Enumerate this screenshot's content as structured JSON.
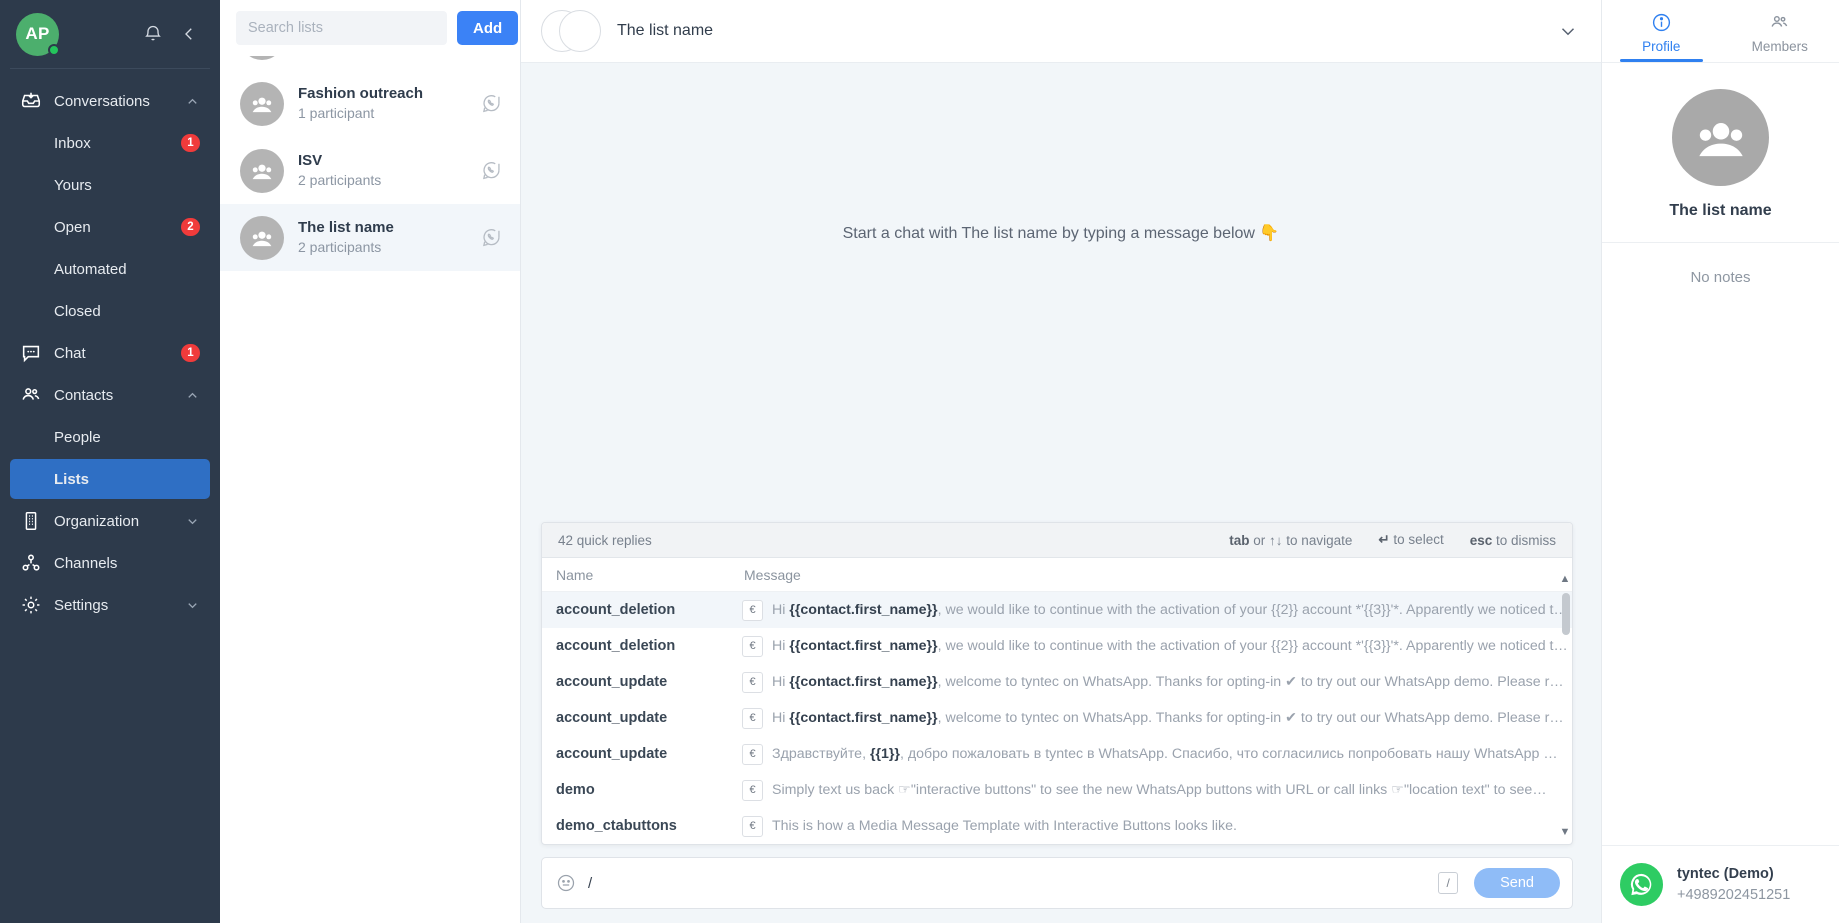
{
  "nav": {
    "avatar_initials": "AP",
    "bell_icon": "bell-icon",
    "collapse_icon": "chevron-left-icon",
    "groups": [
      {
        "id": "conversations",
        "label": "Conversations",
        "icon": "inbox-tray-icon",
        "chevron": "chevron-up-icon",
        "items": [
          {
            "label": "Inbox",
            "badge": "1",
            "active": false
          },
          {
            "label": "Yours",
            "badge": "",
            "active": false
          },
          {
            "label": "Open",
            "badge": "2",
            "active": false
          },
          {
            "label": "Automated",
            "badge": "",
            "active": false
          },
          {
            "label": "Closed",
            "badge": "",
            "active": false
          }
        ]
      },
      {
        "id": "chat",
        "label": "Chat",
        "icon": "chat-bubble-icon",
        "chevron": "",
        "badge": "1",
        "items": []
      },
      {
        "id": "contacts",
        "label": "Contacts",
        "icon": "people-icon",
        "chevron": "chevron-up-icon",
        "items": [
          {
            "label": "People",
            "badge": "",
            "active": false
          },
          {
            "label": "Lists",
            "badge": "",
            "active": true
          }
        ]
      },
      {
        "id": "organization",
        "label": "Organization",
        "icon": "building-icon",
        "chevron": "chevron-down-icon",
        "items": []
      },
      {
        "id": "channels",
        "label": "Channels",
        "icon": "share-nodes-icon",
        "chevron": "",
        "items": []
      },
      {
        "id": "settings",
        "label": "Settings",
        "icon": "gear-icon",
        "chevron": "chevron-down-icon",
        "items": []
      }
    ]
  },
  "lists_panel": {
    "search_placeholder": "Search lists",
    "search_value": "",
    "add_label": "Add",
    "items": [
      {
        "title": "Fashion outreach",
        "subtitle": "1 participant",
        "channel_icon": "whatsapp-outline-icon",
        "selected": false
      },
      {
        "title": "ISV",
        "subtitle": "2 participants",
        "channel_icon": "whatsapp-outline-icon",
        "selected": false
      },
      {
        "title": "The list name",
        "subtitle": "2 participants",
        "channel_icon": "whatsapp-outline-icon",
        "selected": true
      }
    ]
  },
  "chat": {
    "header_title": "The list name",
    "header_chevron": "chevron-down-icon",
    "empty_hint": "Start a chat with The list name by typing a message below 👇",
    "composer": {
      "emoji_icon": "emoji-smiley-icon",
      "value": "/",
      "placeholder": "",
      "slash_icon": "slash-command-icon",
      "send_label": "Send"
    }
  },
  "quick_replies": {
    "count_label": "42 quick replies",
    "hints": [
      {
        "key": "tab",
        "text": " or ↑↓ to navigate"
      },
      {
        "key": "↵",
        "text": " to select"
      },
      {
        "key": "esc",
        "text": " to dismiss"
      }
    ],
    "columns": {
      "name": "Name",
      "message": "Message"
    },
    "rows": [
      {
        "name": "account_deletion",
        "flag": "€",
        "message_prefix": "Hi ",
        "message_bold": "{{contact.first_name}}",
        "message_rest": ", we would like to continue with the activation of your {{2}} account *'{{3}}'*. Apparently we noticed t…",
        "highlight": true
      },
      {
        "name": "account_deletion",
        "flag": "€",
        "message_prefix": "Hi ",
        "message_bold": "{{contact.first_name}}",
        "message_rest": ", we would like to continue with the activation of your {{2}} account *'{{3}}'*. Apparently we noticed t…",
        "highlight": false
      },
      {
        "name": "account_update",
        "flag": "€",
        "message_prefix": "Hi ",
        "message_bold": "{{contact.first_name}}",
        "message_rest": ", welcome to tyntec on WhatsApp. Thanks for opting-in ✔ to try out our WhatsApp demo. Please r…",
        "highlight": false
      },
      {
        "name": "account_update",
        "flag": "€",
        "message_prefix": "Hi ",
        "message_bold": "{{contact.first_name}}",
        "message_rest": ", welcome to tyntec on WhatsApp. Thanks for opting-in ✔ to try out our WhatsApp demo. Please r…",
        "highlight": false
      },
      {
        "name": "account_update",
        "flag": "€",
        "message_prefix": "Здравствуйте, ",
        "message_bold": "{{1}}",
        "message_rest": ", добро пожаловать в tyntec в WhatsApp. Спасибо, что согласились попробовать нашу WhatsApp …",
        "highlight": false
      },
      {
        "name": "demo",
        "flag": "€",
        "message_prefix": "Simply text us back ☞",
        "message_bold": "",
        "message_rest": "\"interactive buttons\" to see the new WhatsApp buttons with URL or call links ☞\"location text\" to see…",
        "highlight": false
      },
      {
        "name": "demo_ctabuttons",
        "flag": "€",
        "message_prefix": "This is how a Media Message Template with Interactive Buttons looks like.",
        "message_bold": "",
        "message_rest": "",
        "highlight": false
      }
    ]
  },
  "right_panel": {
    "tabs": [
      {
        "label": "Profile",
        "icon": "info-circle-icon",
        "active": true
      },
      {
        "label": "Members",
        "icon": "people-icon",
        "active": false
      }
    ],
    "profile_name": "The list name",
    "profile_avatar_icon": "group-avatar-icon",
    "notes_text": "No notes",
    "channel": {
      "icon": "whatsapp-icon",
      "name": "tyntec (Demo)",
      "number": "+4989202451251"
    }
  },
  "colors": {
    "nav_bg": "#2d3a4b",
    "accent_blue": "#3b82f6",
    "active_nav": "#2f6fc4",
    "badge_red": "#f03b3b",
    "whatsapp_green": "#2ecc63",
    "chat_bg": "#f2f6f9"
  }
}
